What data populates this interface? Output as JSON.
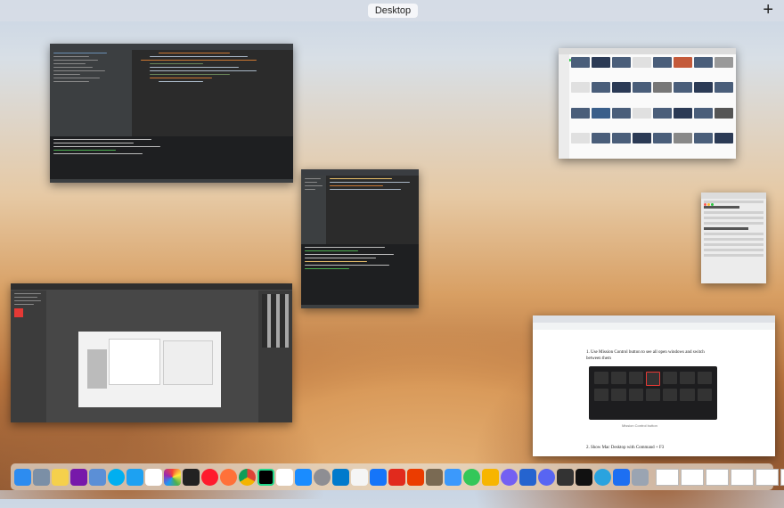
{
  "mission_control": {
    "desktop_label": "Desktop",
    "add_space": "+"
  },
  "browser": {
    "step1": "1. Use Mission Control button to see all open windows and switch between them",
    "caption": "Mission Control button",
    "step2": "2. Show Mac Desktop with Command + F3"
  },
  "colors": {
    "ide_bg": "#2b2b2b",
    "accent_green": "#28c840",
    "code_orange": "#cc7832"
  },
  "dock": {
    "icons": [
      "finder-icon",
      "launchpad-icon",
      "notes-icon",
      "onenote-icon",
      "preview-icon",
      "skype-icon",
      "twitter-icon",
      "calendar-icon",
      "photos-icon",
      "terminal-icon",
      "opera-icon",
      "firefox-icon",
      "chrome-icon",
      "webstorm-icon",
      "slack-icon",
      "app-store-icon",
      "system-preferences-icon",
      "vscode-icon",
      "textedit-icon",
      "xcode-icon",
      "acrobat-icon",
      "office-icon",
      "gimp-icon",
      "mail-icon",
      "messages-icon",
      "sketch-icon",
      "viber-icon",
      "todo-icon",
      "discord-icon",
      "calculator-icon",
      "ide-icon",
      "telegram-icon",
      "keynote-icon",
      "automator-icon",
      "trash-icon"
    ]
  }
}
